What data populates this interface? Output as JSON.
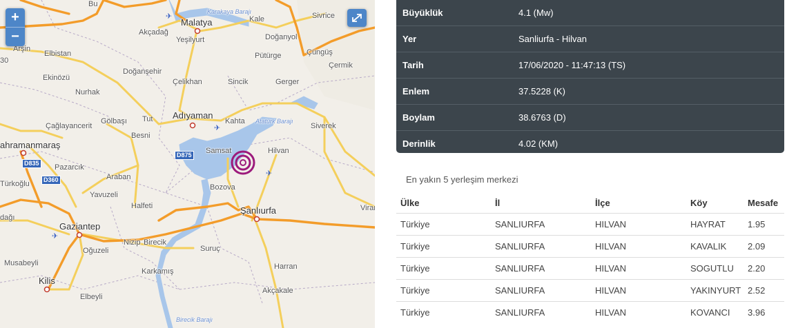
{
  "map": {
    "zoom_in": "+",
    "zoom_out": "−",
    "places": [
      {
        "id": "malatya",
        "label": "Malatya"
      },
      {
        "id": "akcadag",
        "label": "Akçadağ"
      },
      {
        "id": "yesilyurt",
        "label": "Yeşilyurt"
      },
      {
        "id": "kale",
        "label": "Kale"
      },
      {
        "id": "sivrice",
        "label": "Sivrice"
      },
      {
        "id": "dogangol",
        "label": "Doğanyol"
      },
      {
        "id": "arsin",
        "label": "Arşin"
      },
      {
        "id": "elbistan",
        "label": "Elbistan"
      },
      {
        "id": "puturge",
        "label": "Pütürge"
      },
      {
        "id": "cungus",
        "label": "Çüngüş"
      },
      {
        "id": "ekinozu",
        "label": "Ekinözü"
      },
      {
        "id": "dogansehir",
        "label": "Doğanşehir"
      },
      {
        "id": "cermik",
        "label": "Çermik"
      },
      {
        "id": "nurhak",
        "label": "Nurhak"
      },
      {
        "id": "celikhan",
        "label": "Çelikhan"
      },
      {
        "id": "sincik",
        "label": "Sincik"
      },
      {
        "id": "gerger",
        "label": "Gerger"
      },
      {
        "id": "adiyaman",
        "label": "Adıyaman"
      },
      {
        "id": "golbasi",
        "label": "Gölbaşı"
      },
      {
        "id": "tut",
        "label": "Tut"
      },
      {
        "id": "kahta",
        "label": "Kahta"
      },
      {
        "id": "caglayancerit",
        "label": "Çağlayancerit"
      },
      {
        "id": "siverek",
        "label": "Siverek"
      },
      {
        "id": "kahramanmaras",
        "label": "ahramanmaraş"
      },
      {
        "id": "besni",
        "label": "Besni"
      },
      {
        "id": "samsat",
        "label": "Samsat"
      },
      {
        "id": "hilvan",
        "label": "Hilvan"
      },
      {
        "id": "pazarcik",
        "label": "Pazarcık"
      },
      {
        "id": "turkoglu",
        "label": "Türkoğlu"
      },
      {
        "id": "araban",
        "label": "Araban"
      },
      {
        "id": "bozova",
        "label": "Bozova"
      },
      {
        "id": "yavuzeli",
        "label": "Yavuzeli"
      },
      {
        "id": "halfeti",
        "label": "Halfeti"
      },
      {
        "id": "sanliurfa",
        "label": "Şanlıurfa"
      },
      {
        "id": "viran",
        "label": "Viran"
      },
      {
        "id": "dagi",
        "label": "dağı"
      },
      {
        "id": "gaziantep",
        "label": "Gaziantep"
      },
      {
        "id": "nizip",
        "label": "Nizip"
      },
      {
        "id": "birecik",
        "label": "Birecik"
      },
      {
        "id": "oguzeli",
        "label": "Oğuzeli"
      },
      {
        "id": "suruc",
        "label": "Suruç"
      },
      {
        "id": "musabeyli",
        "label": "Musabeyli"
      },
      {
        "id": "harran",
        "label": "Harran"
      },
      {
        "id": "karkamis",
        "label": "Karkamış"
      },
      {
        "id": "kilis",
        "label": "Kilis"
      },
      {
        "id": "akcakale",
        "label": "Akçakale"
      },
      {
        "id": "elbeyli",
        "label": "Elbeyli"
      },
      {
        "id": "bancar",
        "label": "Bu"
      },
      {
        "id": "karakaya",
        "label": "Karakaya Barajı"
      },
      {
        "id": "ataturk",
        "label": "Atatürk Barajı"
      },
      {
        "id": "birecikbaraji",
        "label": "Birecik Barajı"
      },
      {
        "id": "num30",
        "label": "30"
      }
    ],
    "road_shields": [
      {
        "id": "d875",
        "label": "D875"
      },
      {
        "id": "d835",
        "label": "D835"
      },
      {
        "id": "d360",
        "label": "D360"
      }
    ]
  },
  "quake": {
    "rows": [
      {
        "key": "Büyüklük",
        "value": "4.1 (Mw)"
      },
      {
        "key": "Yer",
        "value": "Sanliurfa - Hilvan"
      },
      {
        "key": "Tarih",
        "value": "17/06/2020 - 11:47:13 (TS)"
      },
      {
        "key": "Enlem",
        "value": "37.5228 (K)"
      },
      {
        "key": "Boylam",
        "value": "38.6763 (D)"
      },
      {
        "key": "Derinlik",
        "value": "4.02 (KM)"
      }
    ]
  },
  "nearest": {
    "title": "En yakın 5 yerleşim merkezi",
    "headers": [
      "Ülke",
      "İl",
      "İlçe",
      "Köy",
      "Mesafe"
    ],
    "rows": [
      [
        "Türkiye",
        "SANLIURFA",
        "HILVAN",
        "HAYRAT",
        "1.95"
      ],
      [
        "Türkiye",
        "SANLIURFA",
        "HILVAN",
        "KAVALIK",
        "2.09"
      ],
      [
        "Türkiye",
        "SANLIURFA",
        "HILVAN",
        "SOGUTLU",
        "2.20"
      ],
      [
        "Türkiye",
        "SANLIURFA",
        "HILVAN",
        "YAKINYURT",
        "2.52"
      ],
      [
        "Türkiye",
        "SANLIURFA",
        "HILVAN",
        "KOVANCI",
        "3.96"
      ]
    ]
  },
  "colors": {
    "panel": "#3c454c",
    "motorway": "#f39c2a",
    "trunk": "#f7d66a",
    "water": "#a8c6ea",
    "marker": "#9c1a7c"
  }
}
